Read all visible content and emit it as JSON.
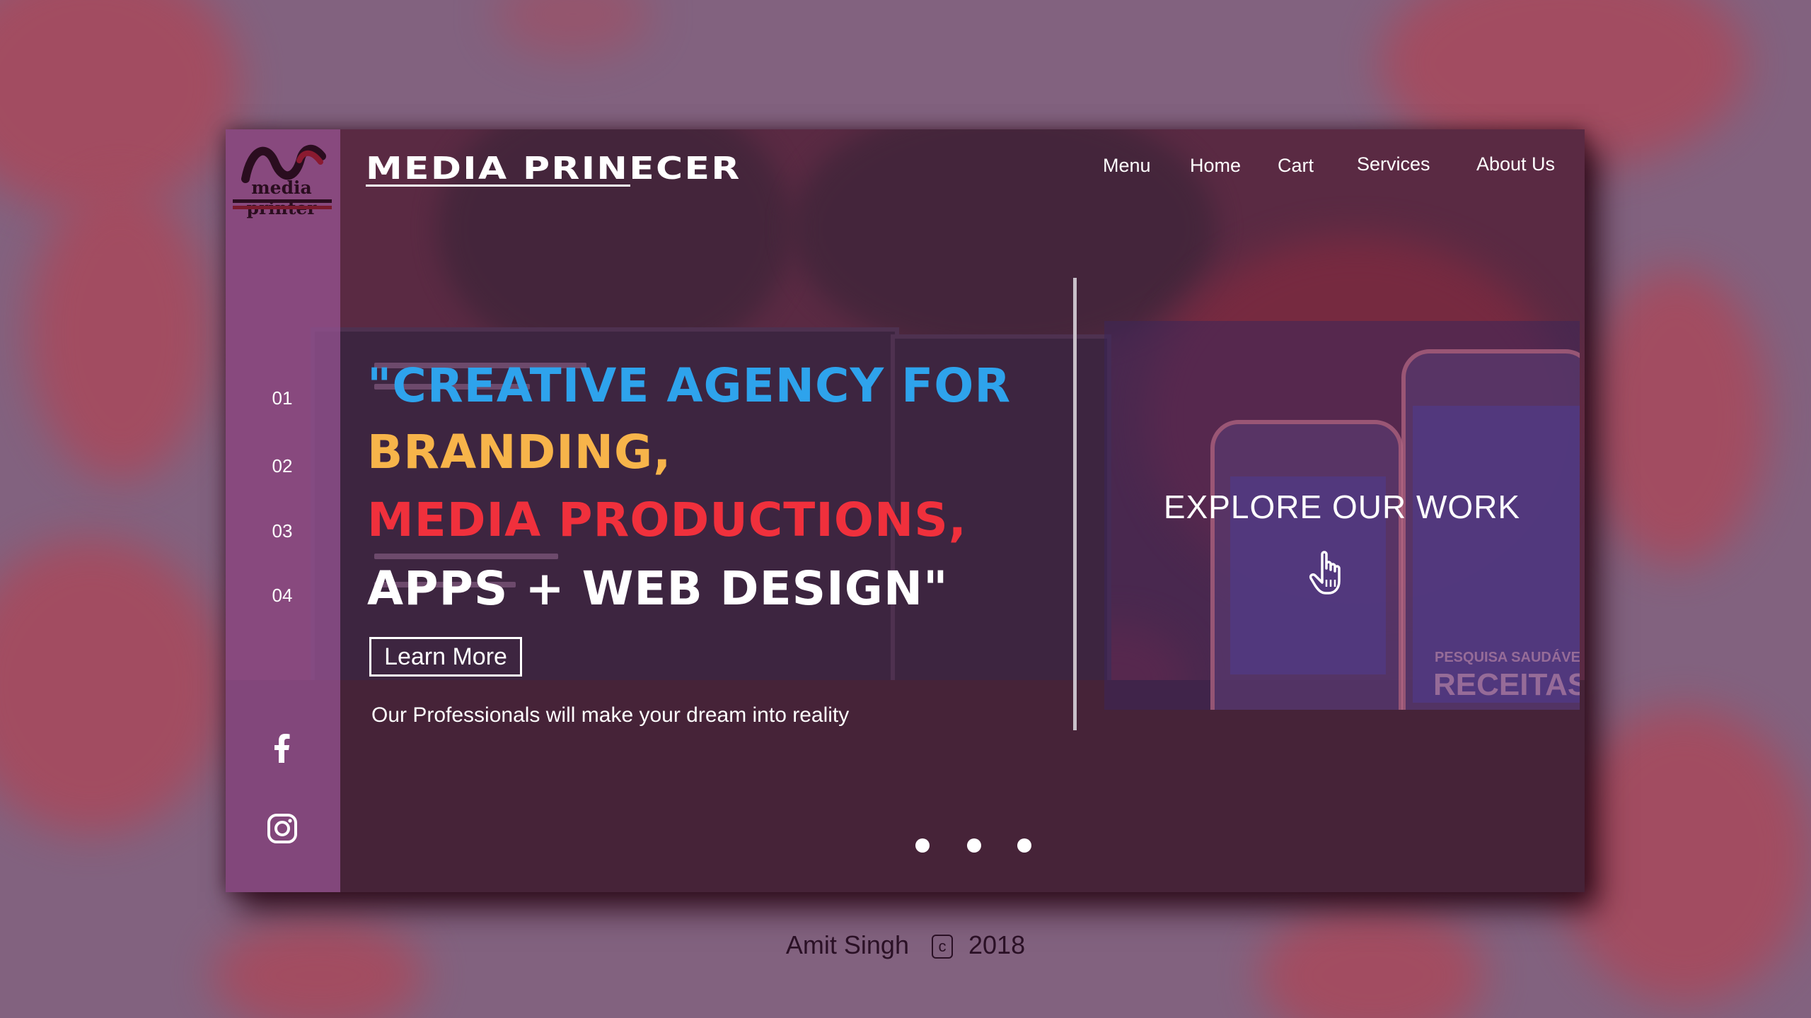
{
  "brand": {
    "logo_text": "media printer",
    "name": "MEDIA PRINECER"
  },
  "nav": {
    "items": [
      "Menu",
      "Home",
      "Cart",
      "Services",
      "About Us"
    ]
  },
  "sidebar": {
    "slide_numbers": [
      "01",
      "02",
      "03",
      "04"
    ],
    "social": [
      "facebook-icon",
      "instagram-icon"
    ]
  },
  "hero": {
    "line1": "\"CREATIVE AGENCY FOR",
    "line2": "BRANDING,",
    "line3": "MEDIA PRODUCTIONS,",
    "line4": "APPS + WEB DESIGN\"",
    "cta_label": "Learn More",
    "tagline": "Our Professionals will make your dream into reality"
  },
  "explore": {
    "title": "EXPLORE OUR WORK",
    "icon": "pointing-hand-icon",
    "bg_text_small": "PESQUISA SAUDÁVE",
    "bg_text_large": "RECEITAS"
  },
  "carousel": {
    "dots": 3
  },
  "footer": {
    "author": "Amit Singh",
    "copyright_symbol": "c",
    "year": "2018"
  },
  "colors": {
    "blue": "#2ea3ec",
    "yellow": "#f7b44a",
    "red": "#f0303c",
    "white": "#ffffff",
    "sidebar": "#9a5696",
    "page_bg": "#82627f"
  }
}
